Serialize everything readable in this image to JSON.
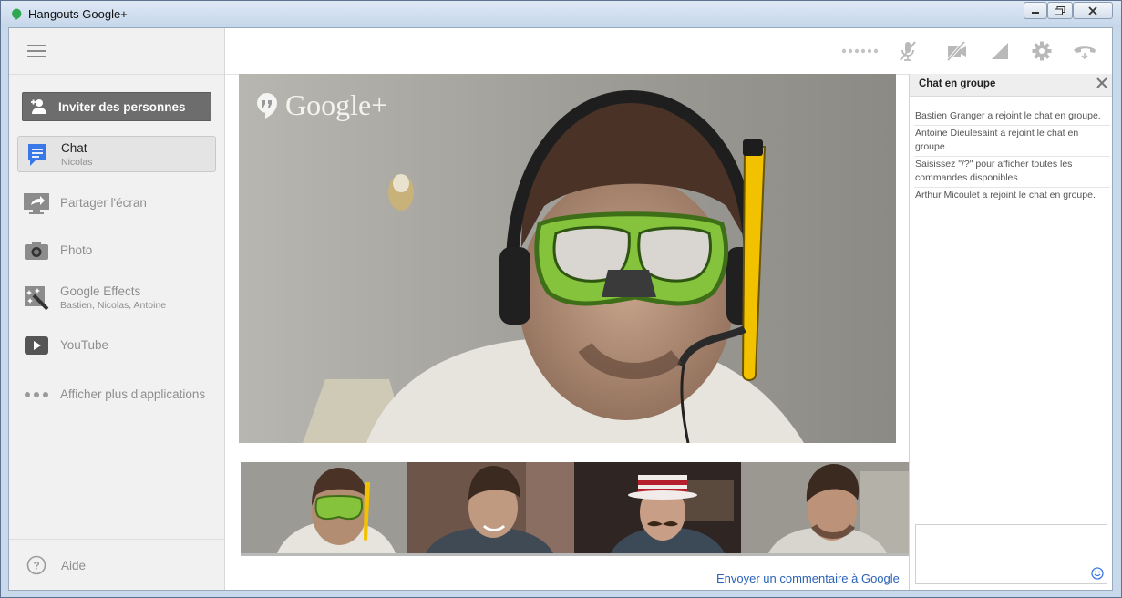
{
  "window": {
    "title": "Hangouts Google+"
  },
  "sidebar": {
    "invite_label": "Inviter des personnes",
    "items": [
      {
        "label": "Chat",
        "sub": "Nicolas",
        "icon": "chat-icon"
      },
      {
        "label": "Partager l'écran",
        "sub": "",
        "icon": "screen-share-icon"
      },
      {
        "label": "Photo",
        "sub": "",
        "icon": "camera-icon"
      },
      {
        "label": "Google Effects",
        "sub": "Bastien, Nicolas, Antoine",
        "icon": "effects-wand-icon"
      },
      {
        "label": "YouTube",
        "sub": "",
        "icon": "youtube-icon"
      },
      {
        "label": "Afficher plus d'applications",
        "sub": "",
        "icon": "more-dots-icon"
      }
    ],
    "help_label": "Aide"
  },
  "toolbar": {
    "icons": [
      "signal-dots-icon",
      "mic-muted-icon",
      "camera-off-icon",
      "bandwidth-icon",
      "settings-gear-icon",
      "hang-up-icon"
    ]
  },
  "video": {
    "watermark": "Google+",
    "participants_count": 4
  },
  "footer": {
    "feedback_link": "Envoyer un commentaire à Google"
  },
  "chat": {
    "title": "Chat en groupe",
    "messages": [
      "Bastien Granger a rejoint le chat en groupe.",
      "Antoine Dieulesaint a rejoint le chat en groupe.",
      "Saisissez \"/?\" pour afficher toutes les commandes disponibles.",
      "Arthur Micoulet a rejoint le chat en groupe."
    ],
    "input_value": ""
  },
  "colors": {
    "invite_bg": "#6d6d6d",
    "link": "#2a63b8",
    "chat_icon_blue": "#3b78e7",
    "snorkel_yellow": "#f2c200",
    "mask_green": "#8dc63f"
  }
}
